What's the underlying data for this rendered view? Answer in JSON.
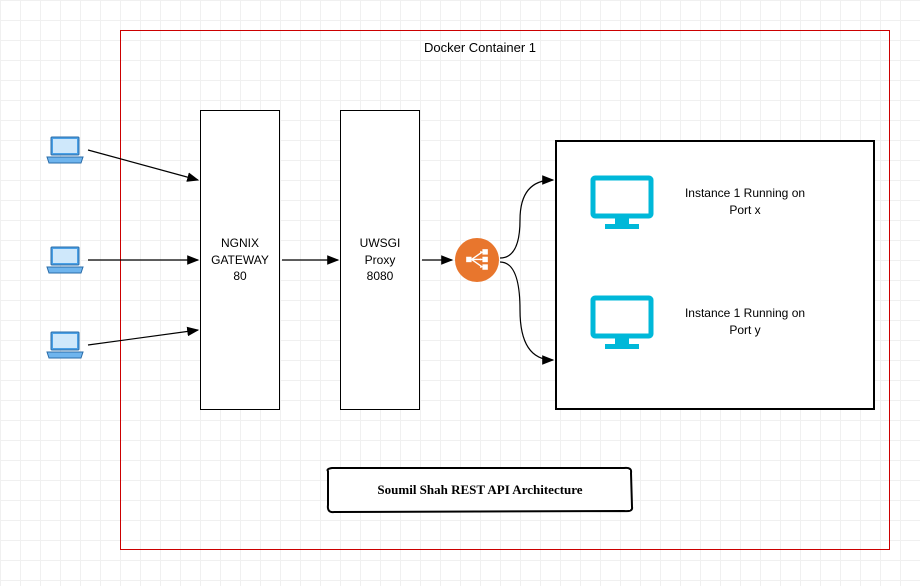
{
  "container": {
    "title": "Docker Container 1"
  },
  "nodes": {
    "nginx": "NGNIX\nGATEWAY\n80",
    "uwsgi": "UWSGI\nProxy\n8080",
    "instance1": "Instance 1 Running on Port x",
    "instance2": "Instance 1 Running on Port y"
  },
  "caption": "Soumil Shah REST API Architecture",
  "icons": {
    "laptop": "laptop-icon",
    "loadbalancer": "load-balancer-icon",
    "monitor": "monitor-icon"
  }
}
